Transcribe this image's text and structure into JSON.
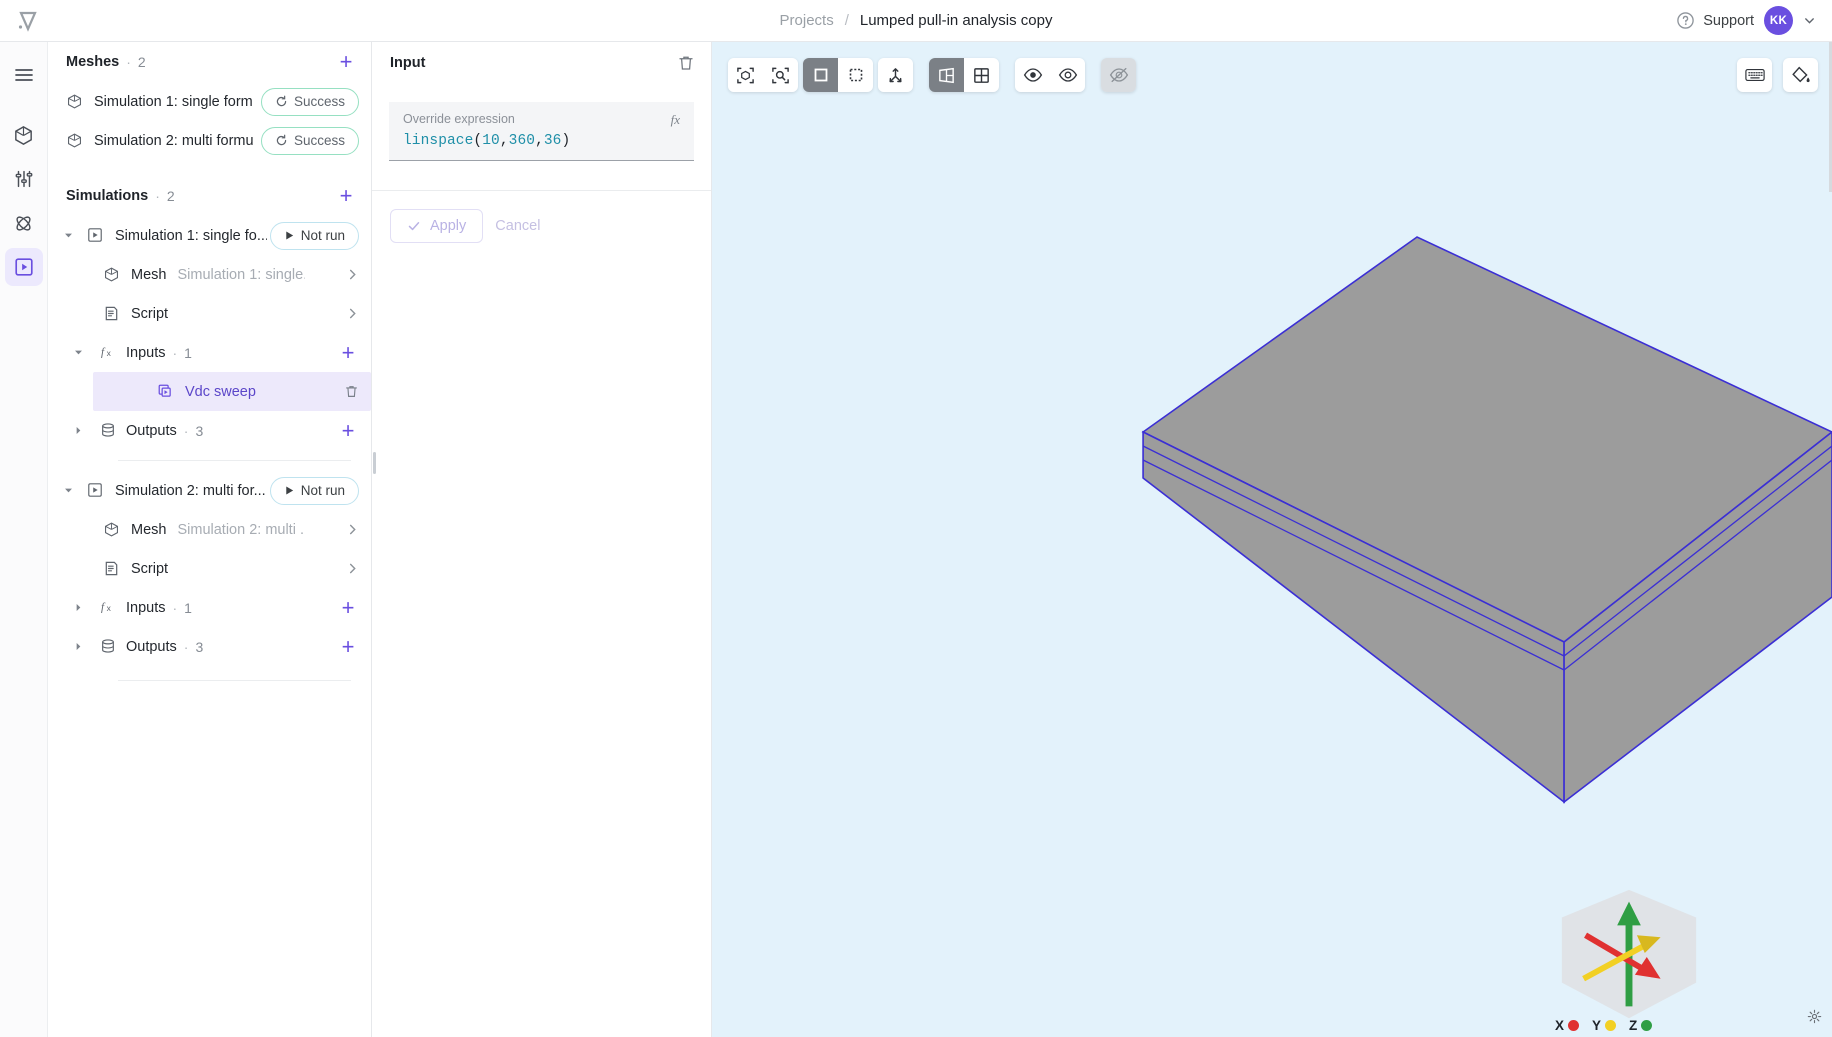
{
  "app": {
    "logo_icon": "vector-logo-icon"
  },
  "header": {
    "breadcrumb_root": "Projects",
    "breadcrumb_separator": "/",
    "breadcrumb_current": "Lumped pull-in analysis copy",
    "support_label": "Support",
    "support_icon": "help-circle-icon",
    "avatar_initials": "KK",
    "avatar_color": "#6a4fe0",
    "account_chevron_icon": "chevron-down-icon"
  },
  "rail": {
    "items": [
      {
        "name": "menu-icon",
        "label": "Menu",
        "active": false
      },
      {
        "name": "geometry-icon",
        "label": "Geometry",
        "active": false
      },
      {
        "name": "settings-icon",
        "label": "Parameters",
        "active": false
      },
      {
        "name": "physics-icon",
        "label": "Physics",
        "active": false
      },
      {
        "name": "simulations-icon",
        "label": "Simulations",
        "active": true
      }
    ]
  },
  "meshes": {
    "title": "Meshes",
    "dot": "·",
    "count": "2",
    "add_label": "+",
    "items": [
      {
        "label": "Simulation 1: single form...",
        "status": "Success",
        "icon": "mesh-cube-icon",
        "status_icon": "refresh-icon"
      },
      {
        "label": "Simulation 2: multi formu...",
        "status": "Success",
        "icon": "mesh-cube-icon",
        "status_icon": "refresh-icon"
      }
    ]
  },
  "simulations": {
    "title": "Simulations",
    "dot": "·",
    "count": "2",
    "add_label": "+",
    "groups": [
      {
        "label": "Simulation 1: single fo...",
        "status": "Not run",
        "status_icon": "play-icon",
        "icon": "simulation-icon",
        "expanded": true,
        "children": [
          {
            "kind": "mesh",
            "label": "Mesh",
            "sub": "Simulation 1: single...",
            "icon": "mesh-cube-icon"
          },
          {
            "kind": "script",
            "label": "Script",
            "sub": "",
            "icon": "script-icon"
          },
          {
            "kind": "inputs",
            "label": "Inputs",
            "dot": "·",
            "count": "1",
            "icon": "fx-icon",
            "expanded": true
          },
          {
            "kind": "input-item",
            "label": "Vdc sweep",
            "icon": "layers-icon",
            "selected": true,
            "delete_icon": "trash-icon"
          },
          {
            "kind": "outputs",
            "label": "Outputs",
            "dot": "·",
            "count": "3",
            "icon": "outputs-icon",
            "expanded": false
          }
        ]
      },
      {
        "label": "Simulation 2: multi for...",
        "status": "Not run",
        "status_icon": "play-icon",
        "icon": "simulation-icon",
        "expanded": true,
        "children": [
          {
            "kind": "mesh",
            "label": "Mesh",
            "sub": "Simulation 2: multi ...",
            "icon": "mesh-cube-icon"
          },
          {
            "kind": "script",
            "label": "Script",
            "sub": "",
            "icon": "script-icon"
          },
          {
            "kind": "inputs",
            "label": "Inputs",
            "dot": "·",
            "count": "1",
            "icon": "fx-icon",
            "expanded": false
          },
          {
            "kind": "outputs",
            "label": "Outputs",
            "dot": "·",
            "count": "3",
            "icon": "outputs-icon",
            "expanded": false
          }
        ]
      }
    ]
  },
  "input_panel": {
    "title": "Input",
    "delete_icon": "trash-icon",
    "expression_label": "Override expression",
    "fx_badge": "fx",
    "expression_tokens": [
      {
        "t": "linspace",
        "cls": "fn"
      },
      {
        "t": "(",
        "cls": "pun"
      },
      {
        "t": "10",
        "cls": "num"
      },
      {
        "t": ",",
        "cls": "pun"
      },
      {
        "t": "360",
        "cls": "num"
      },
      {
        "t": ",",
        "cls": "pun"
      },
      {
        "t": "36",
        "cls": "num"
      },
      {
        "t": ")",
        "cls": "pun"
      }
    ],
    "expression_value": "linspace(10,360,36)",
    "apply_label": "Apply",
    "apply_icon": "check-icon",
    "cancel_label": "Cancel",
    "apply_enabled": false
  },
  "viewport": {
    "background_color": "#e3f2fb",
    "toolbar": [
      {
        "name": "fit-to-view-icon",
        "state": "off"
      },
      {
        "name": "zoom-to-selection-icon",
        "state": "off"
      },
      {
        "name": "select-solid-icon",
        "state": "on"
      },
      {
        "name": "select-box-icon",
        "state": "off"
      },
      {
        "name": "explode-icon",
        "state": "off"
      },
      {
        "name": "split-view-icon",
        "state": "on"
      },
      {
        "name": "grid-view-icon",
        "state": "off"
      },
      {
        "name": "show-hidden-icon",
        "state": "off"
      },
      {
        "name": "hide-icon",
        "state": "off"
      },
      {
        "name": "visibility-off-icon",
        "state": "dim"
      }
    ],
    "right_tools": [
      {
        "name": "keyboard-shortcuts-icon"
      },
      {
        "name": "paint-bucket-icon"
      }
    ],
    "axis_gizmo": {
      "name": "axis-orientation-gizmo",
      "axes": [
        {
          "label": "X",
          "color": "#e03131"
        },
        {
          "label": "Y",
          "color": "#f2d024"
        },
        {
          "label": "Z",
          "color": "#2f9e44"
        }
      ]
    },
    "model": {
      "name": "slab-geometry",
      "face_color": "#9c9c9c",
      "edge_color": "#3b2fd4"
    },
    "corner_icon": "settings-small-icon"
  }
}
